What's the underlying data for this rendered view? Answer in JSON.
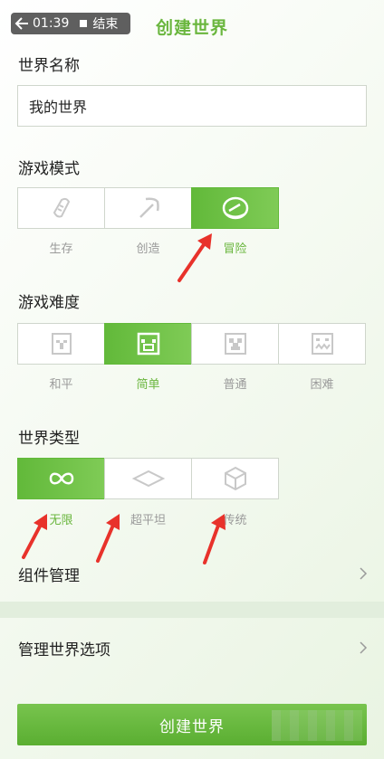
{
  "status": {
    "time": "01:39",
    "stop_label": "结束"
  },
  "header": {
    "title": "创建世界"
  },
  "world_name": {
    "label": "世界名称",
    "value": "我的世界"
  },
  "game_mode": {
    "label": "游戏模式",
    "options": [
      {
        "label": "生存",
        "icon": "bread-icon",
        "selected": false
      },
      {
        "label": "创造",
        "icon": "pickaxe-icon",
        "selected": false
      },
      {
        "label": "冒险",
        "icon": "compass-icon",
        "selected": true
      }
    ]
  },
  "difficulty": {
    "label": "游戏难度",
    "options": [
      {
        "label": "和平",
        "icon": "villager-icon",
        "selected": false
      },
      {
        "label": "简单",
        "icon": "pig-icon",
        "selected": true
      },
      {
        "label": "普通",
        "icon": "creeper-icon",
        "selected": false
      },
      {
        "label": "困难",
        "icon": "ghast-icon",
        "selected": false
      }
    ]
  },
  "world_type": {
    "label": "世界类型",
    "options": [
      {
        "label": "无限",
        "icon": "infinity-icon",
        "selected": true
      },
      {
        "label": "超平坦",
        "icon": "flat-diamond-icon",
        "selected": false
      },
      {
        "label": "传统",
        "icon": "cube-icon",
        "selected": false
      }
    ]
  },
  "menu": {
    "components": "组件管理",
    "manage_options": "管理世界选项"
  },
  "create_button": "创建世界",
  "colors": {
    "accent": "#6ab63e",
    "arrow": "#e8322b"
  }
}
